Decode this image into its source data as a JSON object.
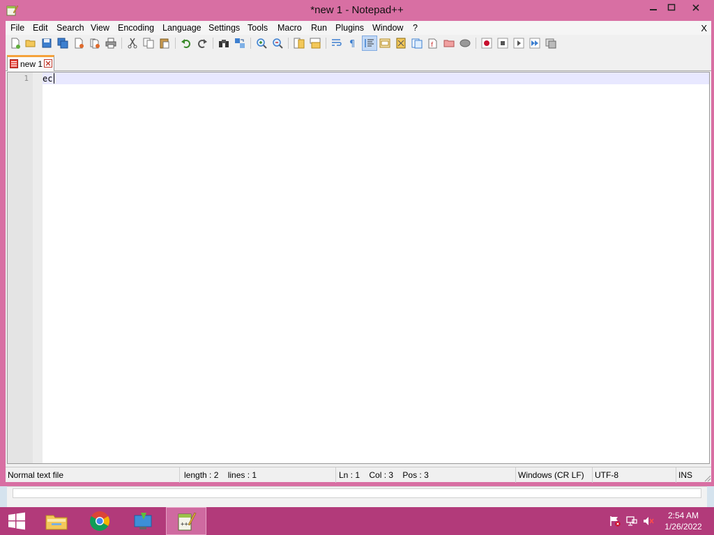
{
  "window": {
    "title": "*new 1 - Notepad++",
    "colors": {
      "frame": "#d86fa3",
      "taskbar": "#b23a7a"
    }
  },
  "menu": {
    "items": [
      "File",
      "Edit",
      "Search",
      "View",
      "Encoding",
      "Language",
      "Settings",
      "Tools",
      "Macro",
      "Run",
      "Plugins",
      "Window",
      "?"
    ],
    "close_label": "X"
  },
  "toolbar": {
    "icons": [
      "new-file",
      "open-file",
      "save",
      "save-all",
      "close",
      "close-all",
      "print",
      "cut",
      "copy",
      "paste",
      "undo",
      "redo",
      "find",
      "replace",
      "zoom-in",
      "zoom-out",
      "sync-vertical",
      "sync-horizontal",
      "word-wrap",
      "show-all-characters",
      "indent-guide",
      "udl",
      "doc-map",
      "function-list",
      "folder-as-workspace",
      "monitoring",
      "record-macro",
      "stop-macro",
      "play-macro",
      "run-macro-multiple",
      "save-macro"
    ]
  },
  "tabs": [
    {
      "label": "new 1",
      "modified": true
    }
  ],
  "editor": {
    "lines": [
      {
        "number": "1",
        "text": "ec"
      }
    ]
  },
  "statusbar": {
    "file_type": "Normal text file",
    "length": "length : 2",
    "lines": "lines : 1",
    "ln": "Ln : 1",
    "col": "Col : 3",
    "pos": "Pos : 3",
    "eol": "Windows (CR LF)",
    "encoding": "UTF-8",
    "mode": "INS"
  },
  "taskbar": {
    "apps": [
      "windows-start",
      "file-explorer",
      "chrome",
      "remote-desktop",
      "notepad-plus-plus"
    ],
    "clock": {
      "time": "2:54 AM",
      "date": "1/26/2022"
    }
  }
}
